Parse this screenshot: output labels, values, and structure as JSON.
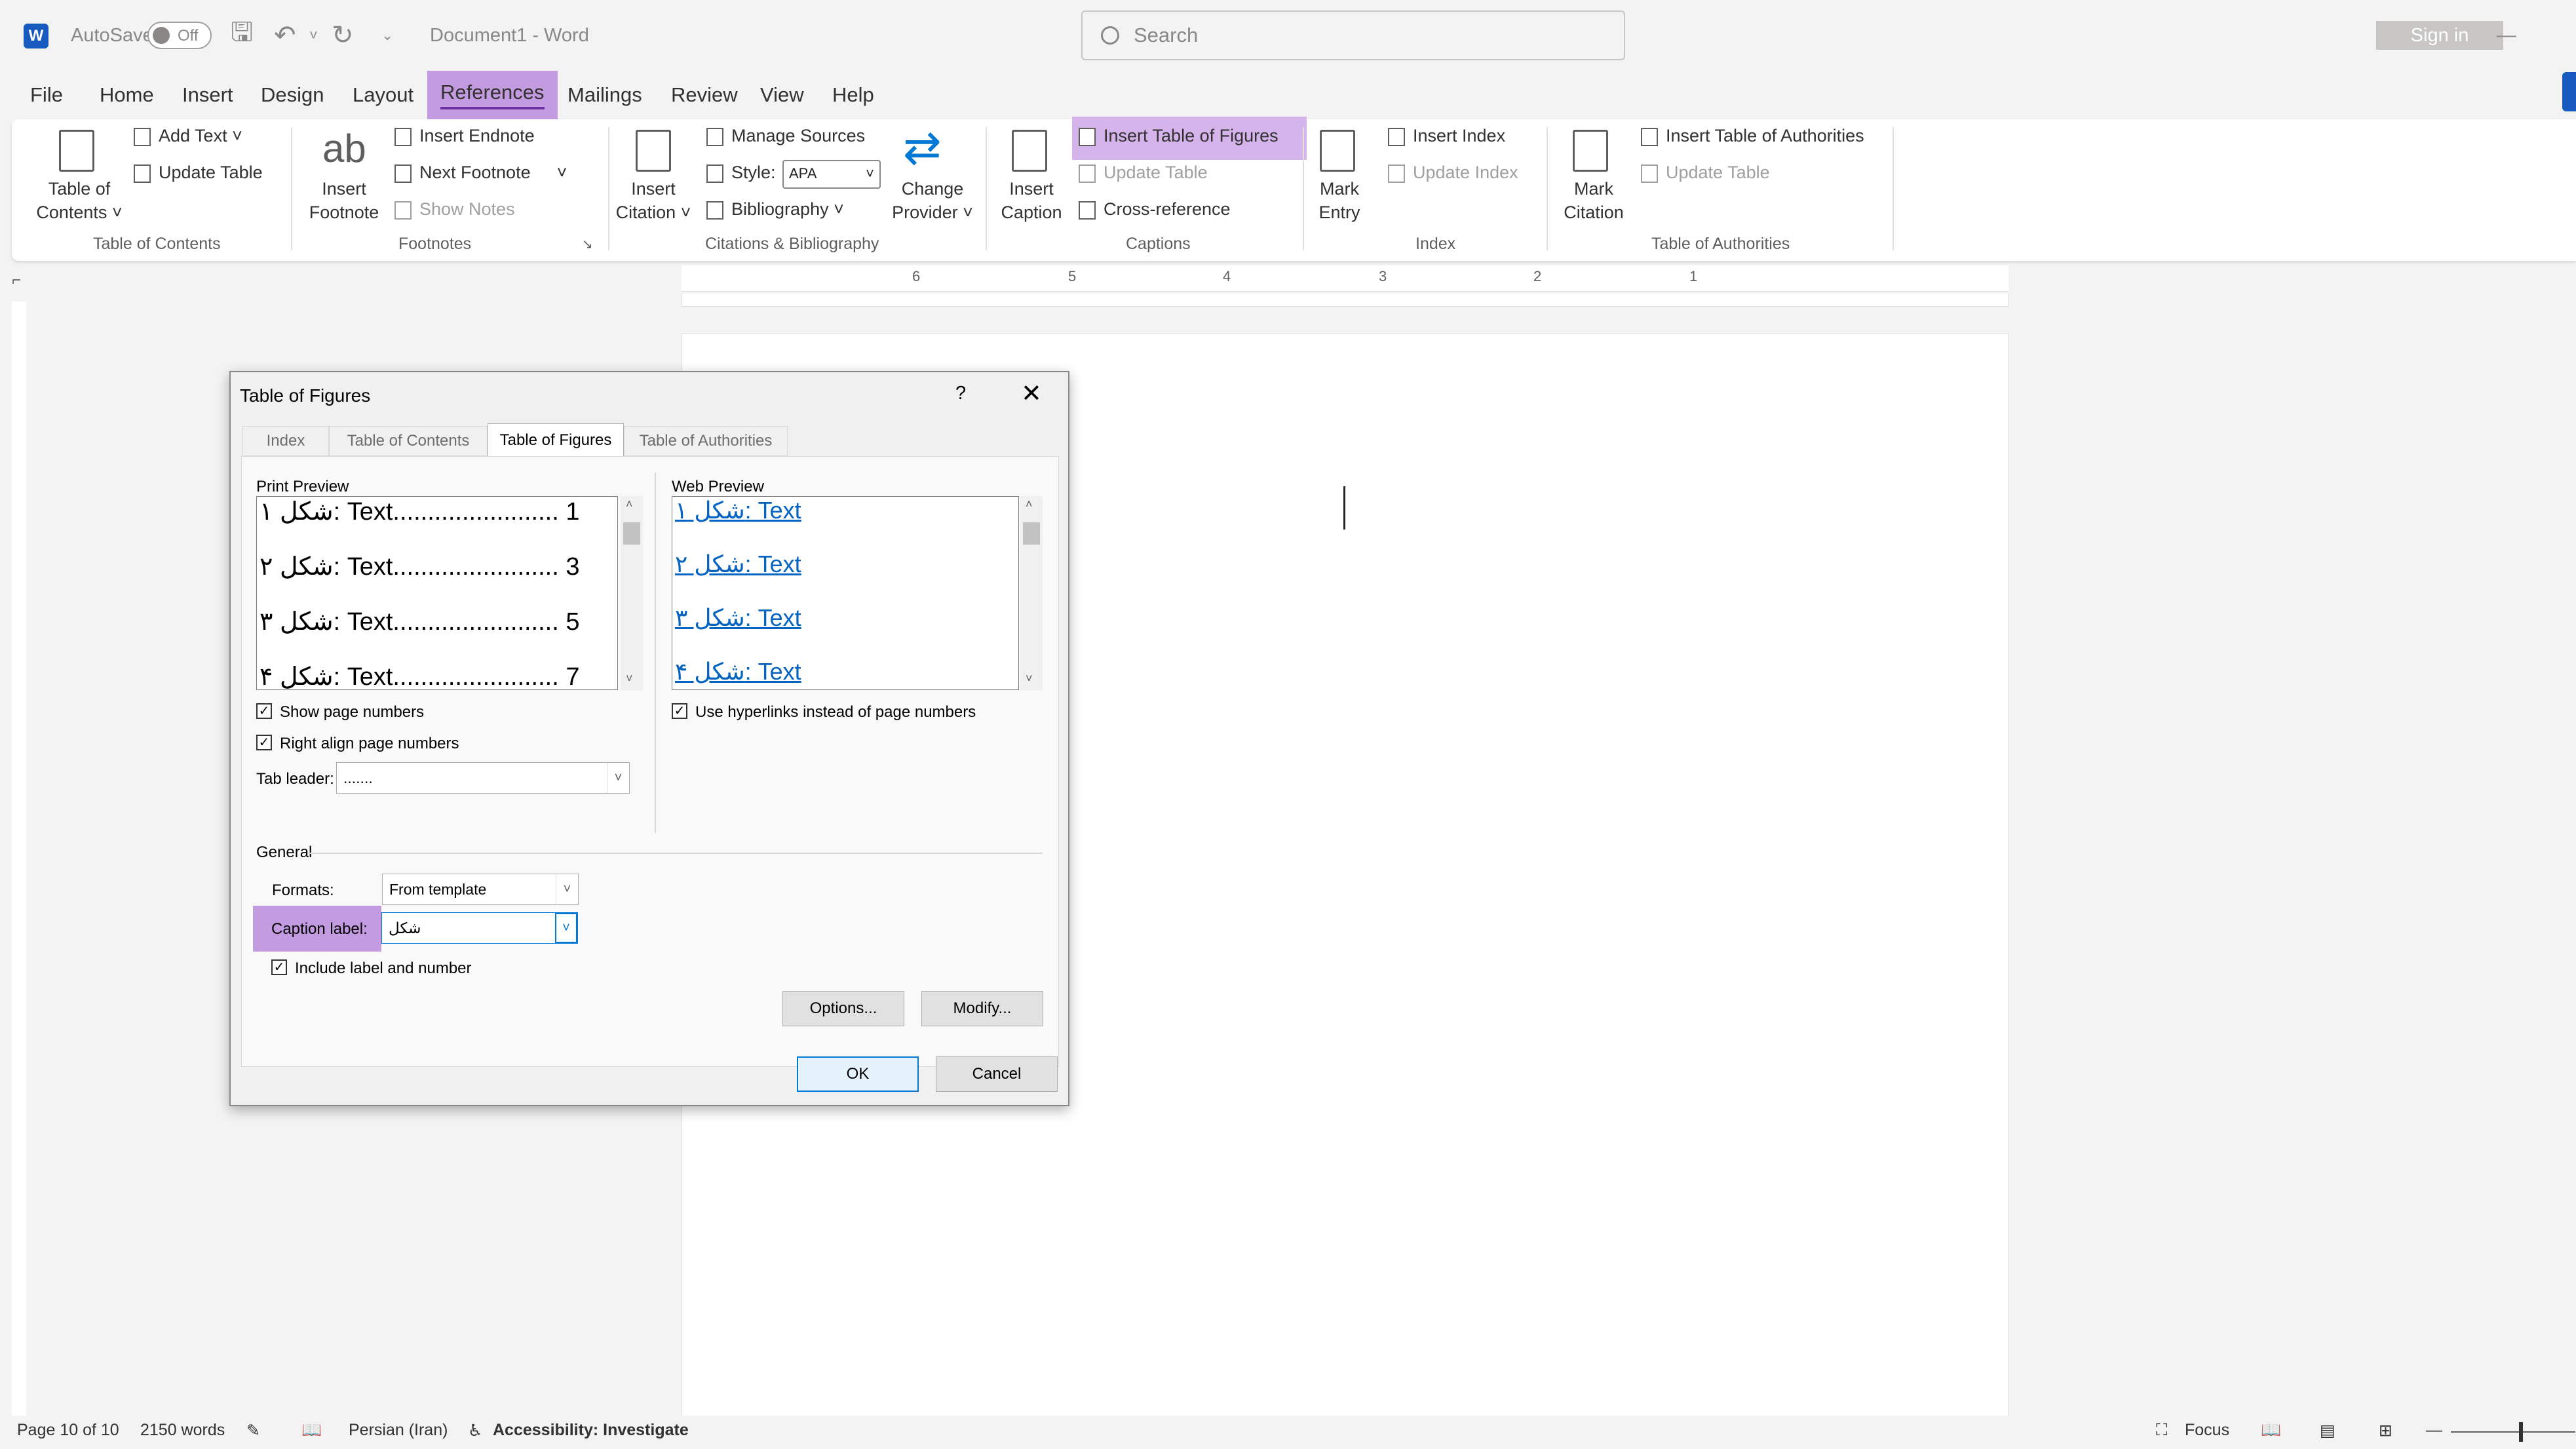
{
  "title_bar": {
    "app_icon": "W",
    "autosave_label": "AutoSave",
    "autosave_state": "Off",
    "document_title": "Document1  -  Word",
    "search_placeholder": "Search",
    "sign_in": "Sign in"
  },
  "menu": [
    "File",
    "Home",
    "Insert",
    "Design",
    "Layout",
    "References",
    "Mailings",
    "Review",
    "View",
    "Help"
  ],
  "ribbon": {
    "toc": {
      "table_of_contents": [
        "Table of",
        "Contents ˅"
      ],
      "add_text": "Add Text ˅",
      "update_table": "Update Table",
      "group": "Table of Contents"
    },
    "footnotes": {
      "insert_footnote": [
        "Insert",
        "Footnote"
      ],
      "insert_endnote": "Insert Endnote",
      "next_footnote": "Next Footnote",
      "show_notes": "Show Notes",
      "group": "Footnotes"
    },
    "citations": {
      "insert_citation": [
        "Insert",
        "Citation ˅"
      ],
      "manage_sources": "Manage Sources",
      "style_label": "Style:",
      "style_value": "APA",
      "bibliography": "Bibliography ˅",
      "change_provider": [
        "Change",
        "Provider ˅"
      ],
      "group": "Citations & Bibliography"
    },
    "captions": {
      "insert_caption": [
        "Insert",
        "Caption"
      ],
      "insert_table_of_figures": "Insert Table of Figures",
      "update_table": "Update Table",
      "cross_reference": "Cross-reference",
      "group": "Captions"
    },
    "index": {
      "mark_entry": [
        "Mark",
        "Entry"
      ],
      "insert_index": "Insert Index",
      "update_index": "Update Index",
      "group": "Index"
    },
    "authorities": {
      "mark_citation": [
        "Mark",
        "Citation"
      ],
      "insert_table_of_authorities": "Insert Table of Authorities",
      "update_table": "Update Table",
      "group": "Table of Authorities"
    }
  },
  "ruler_numbers": [
    "6",
    "5",
    "4",
    "3",
    "2",
    "1"
  ],
  "dialog": {
    "title": "Table of Figures",
    "help": "?",
    "close": "✕",
    "tabs": [
      "Index",
      "Table of Contents",
      "Table of Figures",
      "Table of Authorities"
    ],
    "active_tab": "Table of Figures",
    "print_preview_label": "Print Preview",
    "print_preview": [
      {
        "label": "شکل ۱",
        "text": ": Text",
        "dots": "........................",
        "page": "1"
      },
      {
        "label": "شکل ۲",
        "text": ": Text",
        "dots": "........................",
        "page": "3"
      },
      {
        "label": "شکل ۳",
        "text": ": Text",
        "dots": "........................",
        "page": "5"
      },
      {
        "label": "شکل ۴",
        "text": ": Text",
        "dots": "........................",
        "page": "7"
      }
    ],
    "web_preview_label": "Web Preview",
    "web_preview": [
      {
        "label": "شکل ۱",
        "text": ": Text"
      },
      {
        "label": "شکل ۲",
        "text": ": Text"
      },
      {
        "label": "شکل ۳",
        "text": ": Text"
      },
      {
        "label": "شکل ۴",
        "text": ": Text"
      }
    ],
    "show_page_numbers": "Show page numbers",
    "right_align_page_numbers": "Right align page numbers",
    "use_hyperlinks": "Use hyperlinks instead of page numbers",
    "tab_leader_label": "Tab leader:",
    "tab_leader_value": ".......",
    "general_label": "General",
    "formats_label": "Formats:",
    "formats_value": "From template",
    "caption_label_label": "Caption label:",
    "caption_label_value": "شکل",
    "include_label": "Include label and number",
    "options_button": "Options...",
    "modify_button": "Modify...",
    "ok_button": "OK",
    "cancel_button": "Cancel"
  },
  "status_bar": {
    "page": "Page 10 of 10",
    "words": "2150 words",
    "language": "Persian (Iran)",
    "accessibility": "Accessibility: Investigate",
    "focus": "Focus"
  },
  "colors": {
    "highlight": "#c39be0",
    "accent": "#0078d4",
    "word_blue": "#185abd"
  }
}
